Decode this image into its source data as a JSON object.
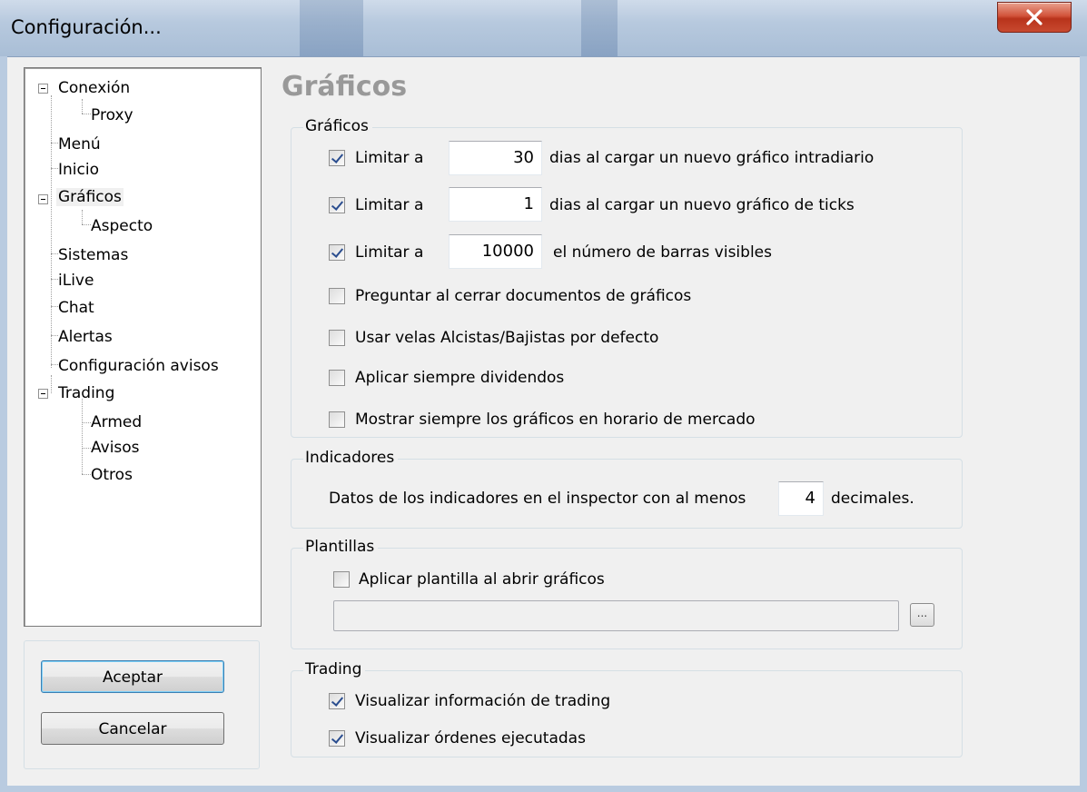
{
  "window": {
    "title": "Configuración...",
    "close_glyph": "X"
  },
  "tree": {
    "items": [
      {
        "label": "Conexión",
        "level": 0,
        "expanded": true
      },
      {
        "label": "Proxy",
        "level": 1
      },
      {
        "label": "Menú",
        "level": 0
      },
      {
        "label": "Inicio",
        "level": 0
      },
      {
        "label": "Gráficos",
        "level": 0,
        "expanded": true,
        "selected": true
      },
      {
        "label": "Aspecto",
        "level": 1
      },
      {
        "label": "Sistemas",
        "level": 0
      },
      {
        "label": "iLive",
        "level": 0
      },
      {
        "label": "Chat",
        "level": 0
      },
      {
        "label": "Alertas",
        "level": 0
      },
      {
        "label": "Configuración avisos",
        "level": 0
      },
      {
        "label": "Trading",
        "level": 0,
        "expanded": true
      },
      {
        "label": "Armed",
        "level": 1
      },
      {
        "label": "Avisos",
        "level": 1
      },
      {
        "label": "Otros",
        "level": 1
      }
    ]
  },
  "buttons": {
    "accept": "Aceptar",
    "cancel": "Cancelar"
  },
  "page": {
    "title": "Gráficos"
  },
  "graficos": {
    "legend": "Gráficos",
    "limits": [
      {
        "checked": true,
        "label": "Limitar a",
        "value": "30",
        "suffix": "dias al cargar un nuevo gráfico intradiario"
      },
      {
        "checked": true,
        "label": "Limitar a",
        "value": "1",
        "suffix": "dias al cargar un nuevo gráfico de ticks"
      },
      {
        "checked": true,
        "label": "Limitar a",
        "value": "10000",
        "suffix": "el número de barras visibles"
      }
    ],
    "options": [
      {
        "checked": false,
        "label": "Preguntar al cerrar documentos de gráficos"
      },
      {
        "checked": false,
        "label": "Usar velas Alcistas/Bajistas por defecto"
      },
      {
        "checked": false,
        "label": "Aplicar siempre dividendos"
      },
      {
        "checked": false,
        "label": "Mostrar siempre los gráficos en horario de mercado"
      }
    ]
  },
  "indicadores": {
    "legend": "Indicadores",
    "prefix": "Datos de los indicadores en el inspector con al menos",
    "value": "4",
    "suffix": "decimales."
  },
  "plantillas": {
    "legend": "Plantillas",
    "apply_checked": false,
    "apply_label": "Aplicar plantilla al abrir gráficos",
    "path_value": "",
    "browse_label": "..."
  },
  "trading": {
    "legend": "Trading",
    "options": [
      {
        "checked": true,
        "label": "Visualizar información de trading"
      },
      {
        "checked": true,
        "label": "Visualizar órdenes ejecutadas"
      }
    ]
  },
  "colors": {
    "title_bar": "#b7c9de",
    "close_button": "#c8492f",
    "check_mark": "#2a4d8f",
    "page_title": "#999999"
  }
}
